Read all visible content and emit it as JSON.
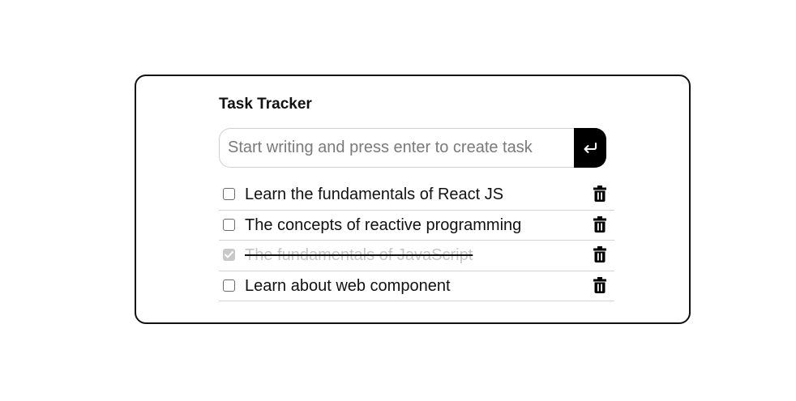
{
  "app": {
    "title": "Task Tracker"
  },
  "input": {
    "placeholder": "Start writing and press enter to create task",
    "value": "",
    "submit_icon": "enter-return-icon"
  },
  "tasks": [
    {
      "label": "Learn the fundamentals of React JS",
      "completed": false
    },
    {
      "label": "The concepts of reactive programming",
      "completed": false
    },
    {
      "label": "The fundamentals of JavaScript",
      "completed": true
    },
    {
      "label": "Learn about web component",
      "completed": false
    }
  ],
  "icons": {
    "delete": "trash-icon"
  },
  "colors": {
    "accent": "#000000",
    "completed_text": "#c6c6c6",
    "divider": "#d4d4d4"
  }
}
